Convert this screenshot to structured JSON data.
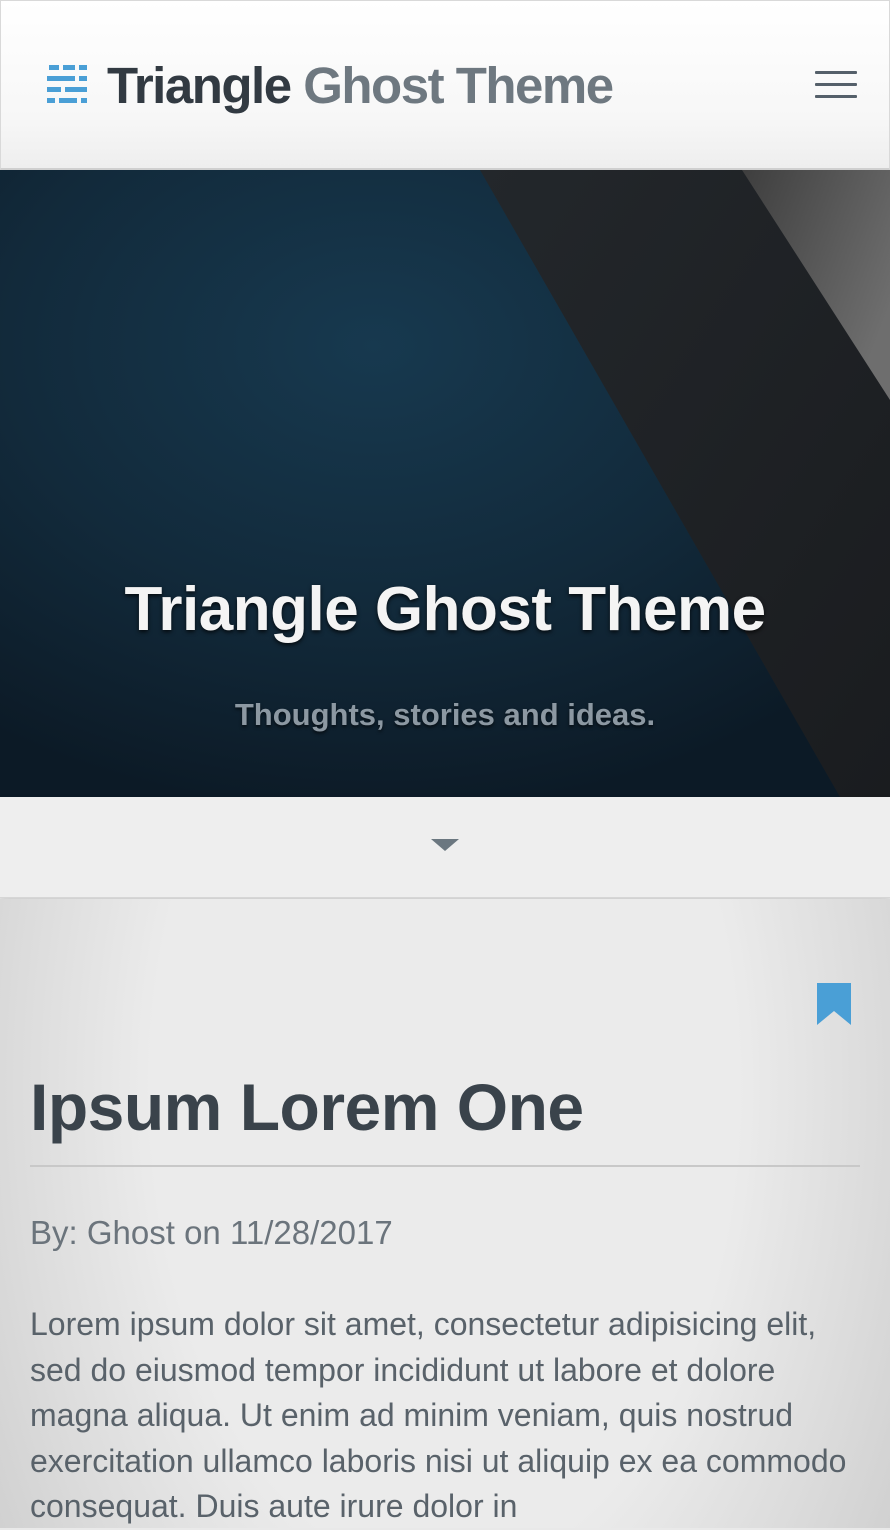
{
  "header": {
    "logo_icon": "triangle-lines-logo",
    "title_part1": "Triangle",
    "title_part2": "Ghost Theme",
    "menu_icon": "hamburger-icon"
  },
  "hero": {
    "title": "Triangle Ghost Theme",
    "subtitle": "Thoughts, stories and ideas."
  },
  "scroll": {
    "icon": "chevron-down-icon"
  },
  "post": {
    "bookmark_icon": "bookmark-icon",
    "title": "Ipsum Lorem One",
    "meta_prefix": "By:",
    "author": "Ghost",
    "meta_on": "on",
    "date": "11/28/2017",
    "excerpt": "Lorem ipsum dolor sit amet, consectetur adipisicing elit, sed do eiusmod tempor incididunt ut labore et dolore magna aliqua. Ut enim ad minim veniam, quis nostrud exercitation ullamco laboris nisi ut aliquip ex ea commodo consequat. Duis aute irure dolor in"
  },
  "colors": {
    "accent": "#4a9fd6",
    "header_text": "#323a42",
    "header_text_light": "#6e7880",
    "hero_bg": "#0f2231"
  }
}
